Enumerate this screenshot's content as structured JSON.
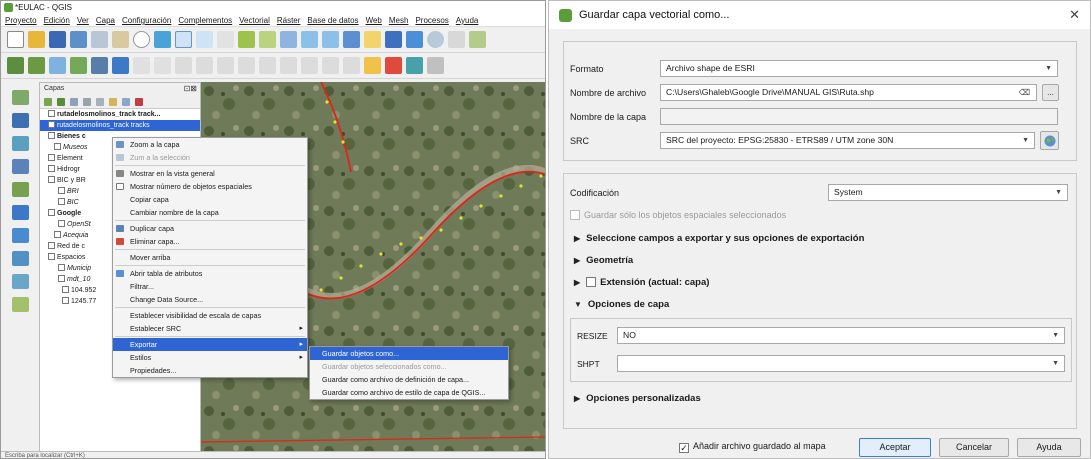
{
  "qgis": {
    "title": "*EULAC - QGIS",
    "menu": [
      "Proyecto",
      "Edición",
      "Ver",
      "Capa",
      "Configuración",
      "Complementos",
      "Vectorial",
      "Ráster",
      "Base de datos",
      "Web",
      "Mesh",
      "Procesos",
      "Ayuda"
    ],
    "layers_panel": {
      "title": "Capas",
      "rows": [
        {
          "label": "rutadelosmolinos_track track...",
          "bold": true
        },
        {
          "label": "rutadelosmolinos_track tracks",
          "selected": true
        },
        {
          "label": "Bienes c",
          "bold": true
        },
        {
          "label": "Museos",
          "italic": true
        },
        {
          "label": "Element"
        },
        {
          "label": "Hidrogr"
        },
        {
          "label": "BIC y BR"
        },
        {
          "label": "BRI",
          "italic": true
        },
        {
          "label": "BIC",
          "italic": true
        },
        {
          "label": "Google",
          "bold": true
        },
        {
          "label": "OpenSt",
          "italic": true
        },
        {
          "label": "Acequia",
          "italic": true
        },
        {
          "label": "Red de c"
        },
        {
          "label": "Espacios"
        },
        {
          "label": "Municip",
          "italic": true
        },
        {
          "label": "mdt_10",
          "italic": true
        },
        {
          "label": "104.952"
        },
        {
          "label": "1245.77"
        }
      ]
    },
    "context_menu": {
      "items": [
        {
          "label": "Zoom a la capa",
          "icon": "zoom-layer-icon"
        },
        {
          "label": "Zum a la selección",
          "icon": "zoom-selection-icon",
          "disabled": true
        },
        {
          "label": "Mostrar en la vista general",
          "icon": "overview-icon"
        },
        {
          "label": "Mostrar número de objetos espaciales",
          "icon": "checkbox-icon"
        },
        {
          "label": "Copiar capa"
        },
        {
          "label": "Cambiar nombre de la capa"
        },
        {
          "label": "Duplicar capa",
          "icon": "duplicate-icon"
        },
        {
          "label": "Eliminar capa...",
          "icon": "remove-layer-icon"
        },
        {
          "label": "Mover arriba"
        },
        {
          "label": "Abrir tabla de atributos",
          "icon": "attribute-table-icon"
        },
        {
          "label": "Filtrar..."
        },
        {
          "label": "Change Data Source..."
        },
        {
          "label": "Establecer visibilidad de escala de capas"
        },
        {
          "label": "Establecer SRC",
          "submenu": true
        },
        {
          "label": "Exportar",
          "submenu": true,
          "highlighted": true
        },
        {
          "label": "Estilos",
          "submenu": true
        },
        {
          "label": "Propiedades..."
        }
      ]
    },
    "export_submenu": {
      "items": [
        {
          "label": "Guardar objetos como...",
          "highlighted": true
        },
        {
          "label": "Guardar objetos seleccionados como...",
          "disabled": true
        },
        {
          "label": "Guardar como archivo de definición de capa..."
        },
        {
          "label": "Guardar como archivo de estilo de capa de QGIS..."
        }
      ]
    },
    "status_text": "Escriba para localizar (Ctrl+K)"
  },
  "dialog": {
    "title": "Guardar capa vectorial como...",
    "format_label": "Formato",
    "format_value": "Archivo shape de ESRI",
    "filename_label": "Nombre de archivo",
    "filename_value": "C:\\Users\\Ghaleb\\Google Drive\\MANUAL GIS\\Ruta.shp",
    "browse_label": "...",
    "layername_label": "Nombre de la capa",
    "layername_value": "",
    "crs_label": "SRC",
    "crs_value": "SRC del proyecto: EPSG:25830 - ETRS89 / UTM zone 30N",
    "encoding_label": "Codificación",
    "encoding_value": "System",
    "selected_only_label": "Guardar sólo los objetos espaciales seleccionados",
    "section_fields": "Seleccione campos a exportar y sus opciones de exportación",
    "section_geometry": "Geometría",
    "section_extent": "Extensión (actual: capa)",
    "section_layer_options": "Opciones de capa",
    "resize_label": "RESIZE",
    "resize_value": "NO",
    "shpt_label": "SHPT",
    "shpt_value": "",
    "section_custom": "Opciones personalizadas",
    "add_to_map_label": "Añadir archivo guardado al mapa",
    "ok_label": "Aceptar",
    "cancel_label": "Cancelar",
    "help_label": "Ayuda"
  }
}
